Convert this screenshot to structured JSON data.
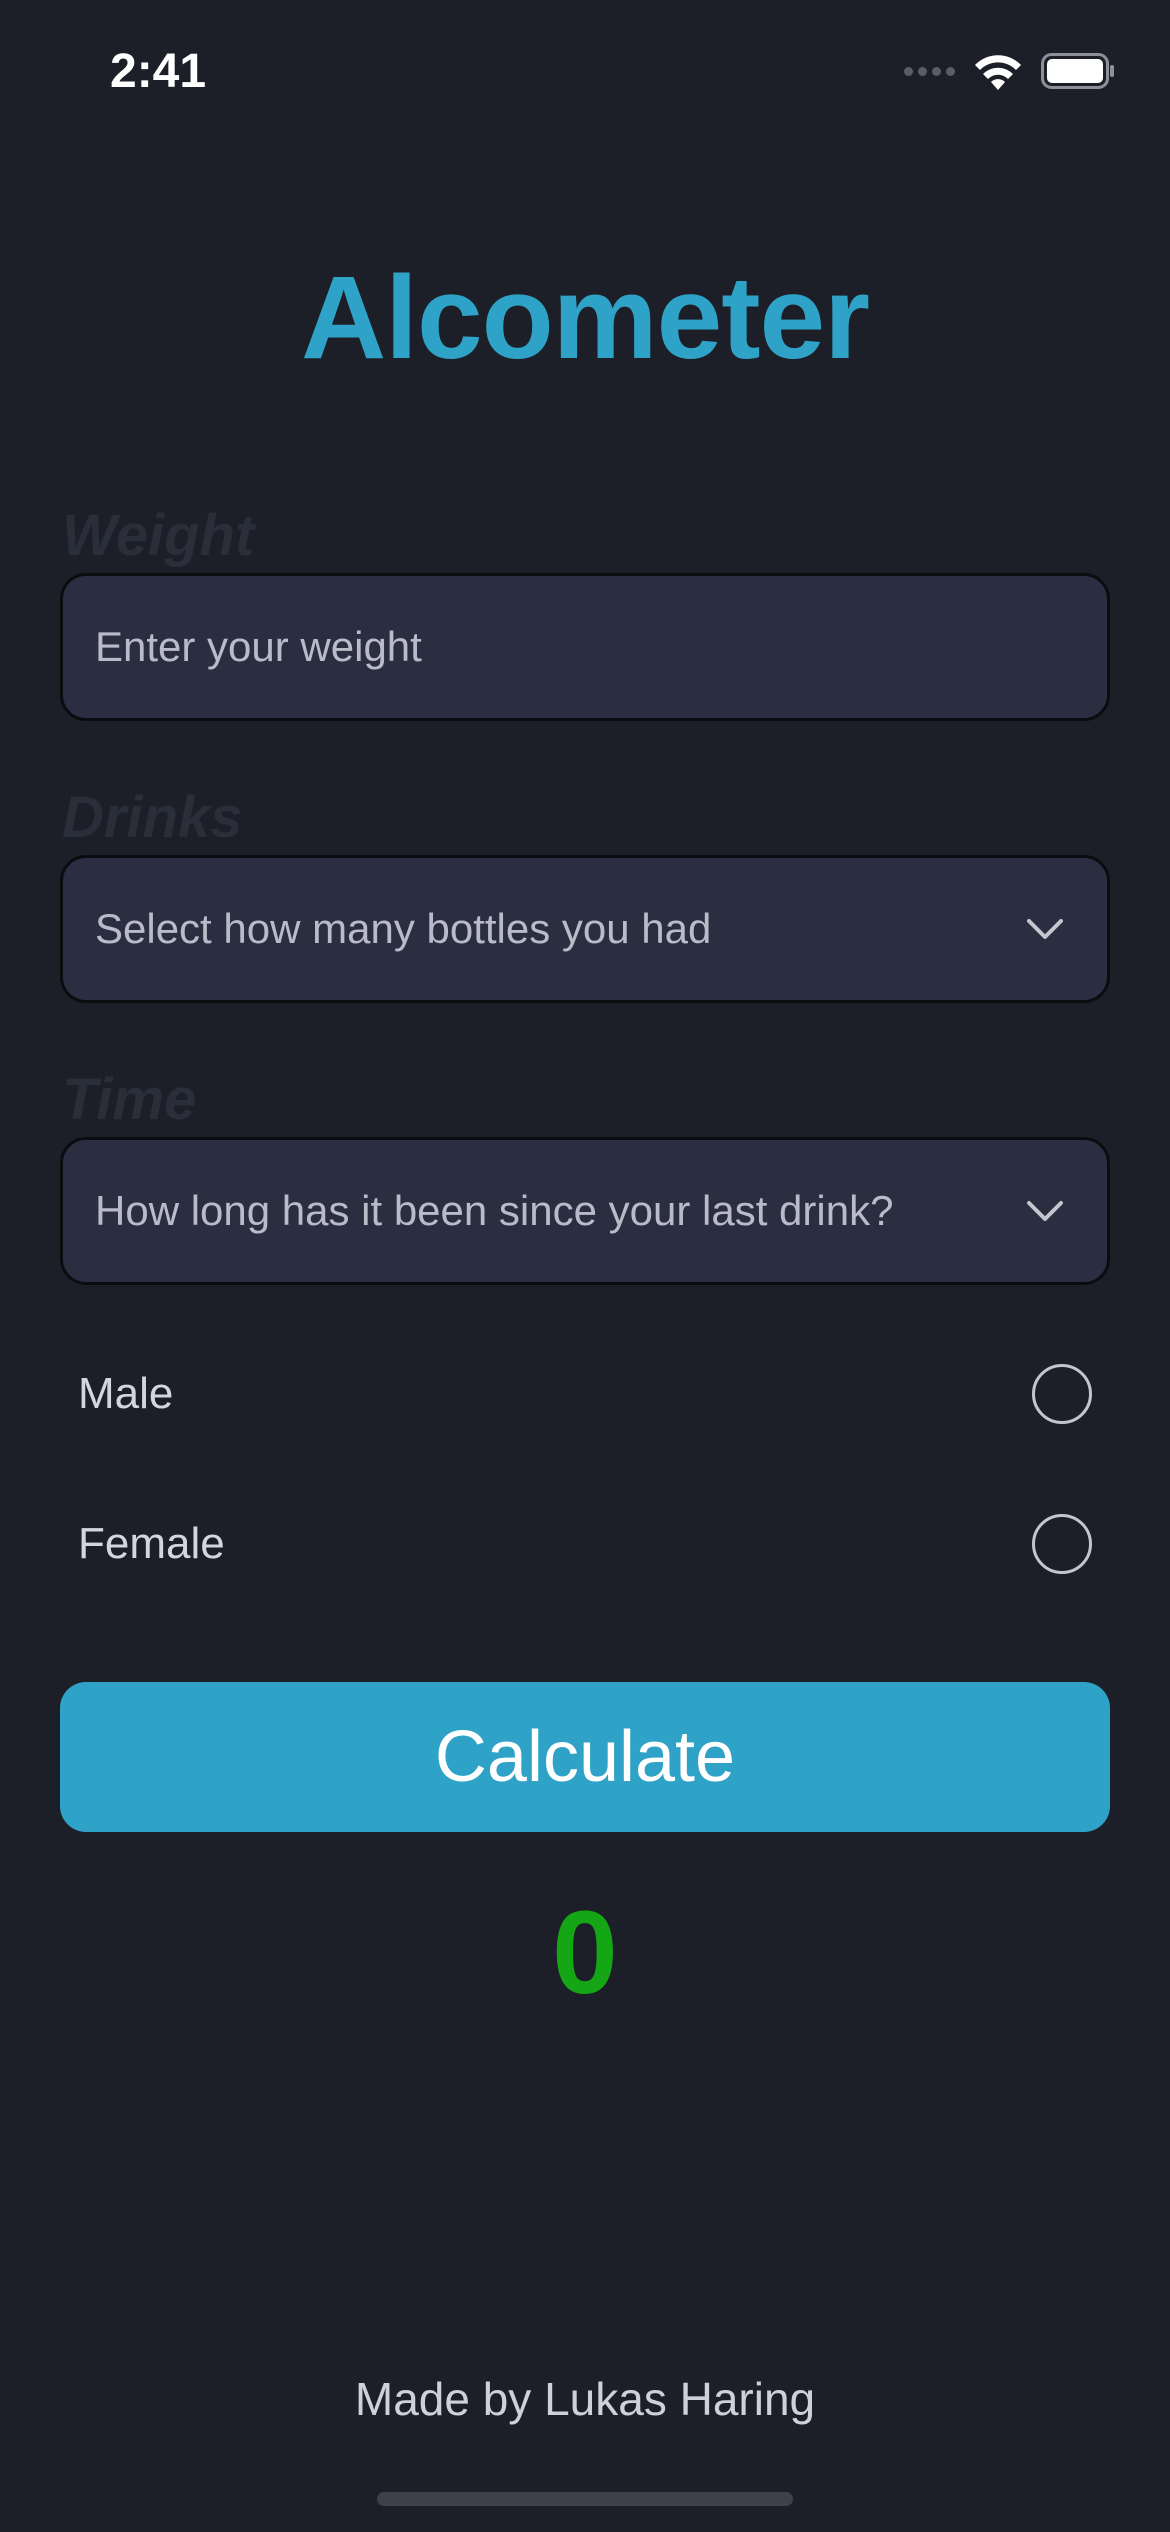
{
  "status_bar": {
    "time": "2:41",
    "icons": [
      "signal-icon",
      "wifi-icon",
      "battery-icon"
    ]
  },
  "app": {
    "title": "Alcometer"
  },
  "form": {
    "weight": {
      "label": "Weight",
      "placeholder": "Enter your weight"
    },
    "drinks": {
      "label": "Drinks",
      "placeholder": "Select how many bottles you had"
    },
    "time": {
      "label": "Time",
      "placeholder": "How long has it been since your last drink?"
    },
    "gender_options": [
      {
        "label": "Male",
        "selected": false
      },
      {
        "label": "Female",
        "selected": false
      }
    ]
  },
  "actions": {
    "calculate_label": "Calculate"
  },
  "result": {
    "value": "0"
  },
  "footer": {
    "credit": "Made by Lukas Haring"
  },
  "colors": {
    "background": "#1c1f28",
    "accent": "#2fa3c7",
    "result": "#14a614",
    "field_bg": "#2b2e40"
  }
}
